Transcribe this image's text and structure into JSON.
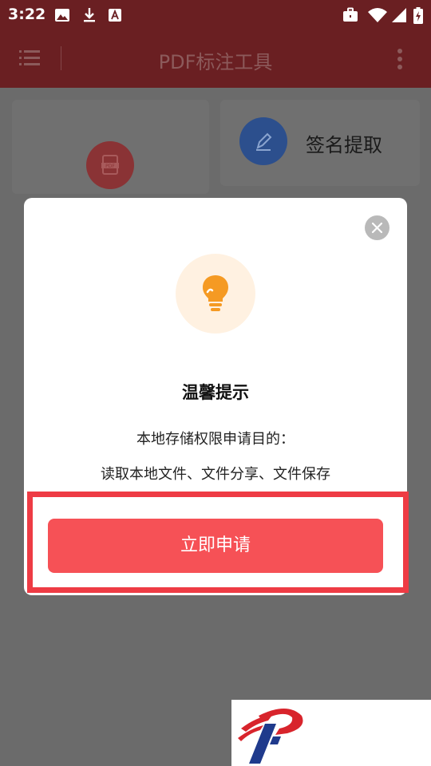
{
  "status_bar": {
    "time": "3:22",
    "left_icons": [
      "image-icon",
      "download-icon",
      "a-badge-icon"
    ],
    "right_icons": [
      "briefcase-icon",
      "wifi-icon",
      "signal-icon",
      "battery-charging-icon"
    ]
  },
  "app_bar": {
    "title": "PDF标注工具",
    "left_icon": "menu-list-icon",
    "right_icon": "more-vert-icon"
  },
  "cards": [
    {
      "label": "",
      "icon": "pdf-file-icon",
      "color": "#8a3335"
    },
    {
      "label": "签名提取",
      "icon": "pen-icon",
      "color": "#2c4f8d"
    }
  ],
  "dialog": {
    "icon": "lightbulb-icon",
    "title": "温馨提示",
    "line1": "本地存储权限申请目的：",
    "line2": "读取本地文件、文件分享、文件保存",
    "button_label": "立即申请",
    "close_icon": "close-icon"
  },
  "colors": {
    "app_bar": "#6a1f22",
    "button": "#f65156",
    "highlight": "#ee3b44",
    "bulb": "#f59a23"
  },
  "watermark": {
    "logo": "p-logo-icon"
  }
}
